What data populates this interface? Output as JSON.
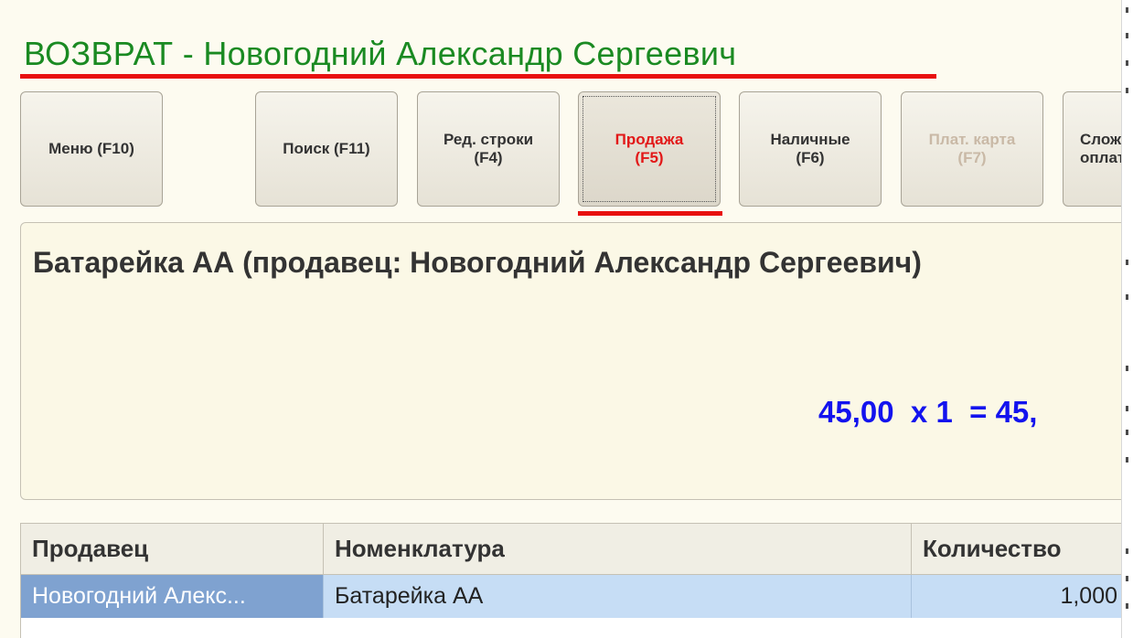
{
  "title": "ВОЗВРАТ - Новогодний Александр Сергеевич",
  "toolbar": {
    "menu": "Меню (F10)",
    "search": "Поиск (F11)",
    "edit_rows": "Ред. строки\n(F4)",
    "sale": "Продажа\n(F5)",
    "cash": "Наличные\n(F6)",
    "card": "Плат. карта\n(F7)",
    "complex": "Слож\nоплат"
  },
  "current_item": {
    "name": "Батарейка АА (продавец: Новогодний Александр Сергеевич)",
    "calc": "45,00  x 1  = 45,"
  },
  "table": {
    "columns": [
      "Продавец",
      "Номенклатура",
      "Количество"
    ],
    "rows": [
      [
        "Новогодний Алекс...",
        "Батарейка АА",
        "1,000"
      ]
    ]
  },
  "colors": {
    "title": "#1a8a22",
    "highlight_underline": "#e81010",
    "active_button_text": "#e21818",
    "price": "#1313ee",
    "selected_row": "#c6ddf5",
    "selected_cell": "#7fa2d0"
  }
}
